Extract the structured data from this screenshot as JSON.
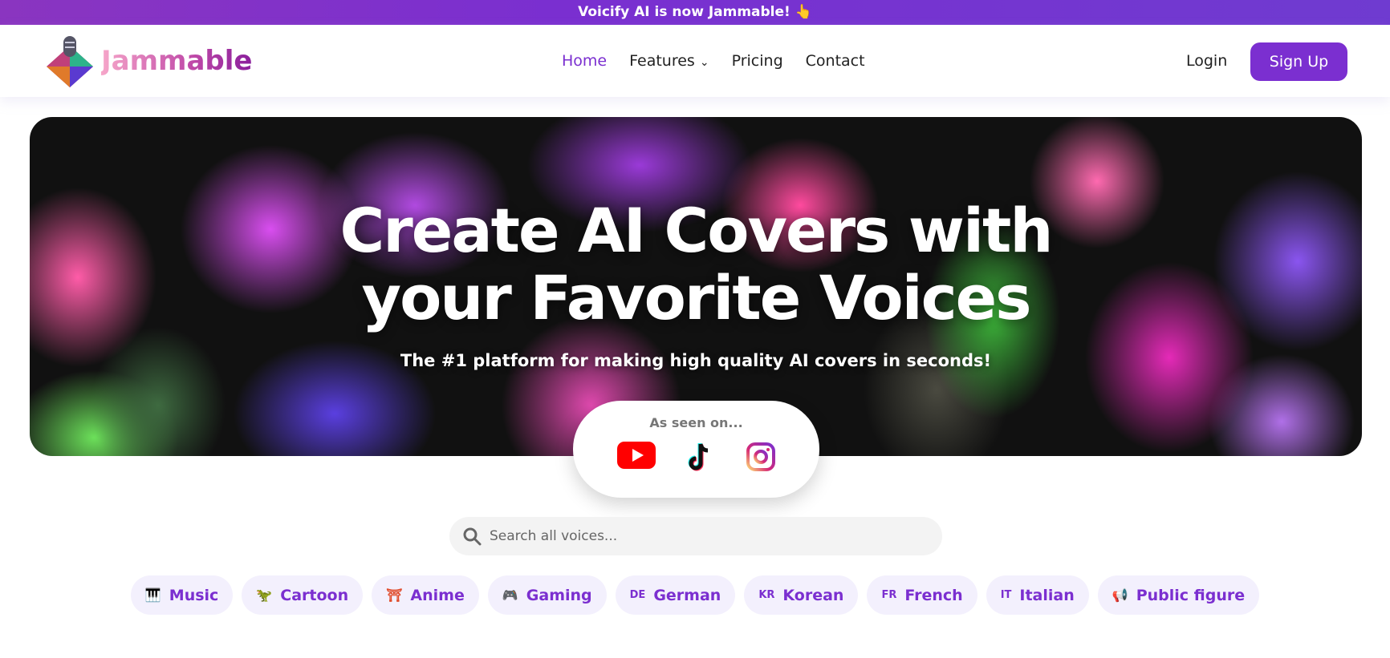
{
  "banner": {
    "text": "Voicify AI is now Jammable! 👆"
  },
  "logo": {
    "text": "Jammable"
  },
  "nav": {
    "items": [
      {
        "label": "Home",
        "active": true
      },
      {
        "label": "Features",
        "dropdown": true
      },
      {
        "label": "Pricing"
      },
      {
        "label": "Contact"
      }
    ],
    "login": "Login",
    "signup": "Sign Up"
  },
  "hero": {
    "title_line1": "Create AI Covers with",
    "title_line2": "your Favorite Voices",
    "subtitle": "The #1 platform for making high quality AI covers in seconds!"
  },
  "seen_on": {
    "label": "As seen on...",
    "platforms": [
      "youtube-icon",
      "tiktok-icon",
      "instagram-icon"
    ]
  },
  "search": {
    "placeholder": "Search all voices..."
  },
  "categories": [
    {
      "icon": "🎹",
      "label": "Music"
    },
    {
      "icon": "🦖",
      "label": "Cartoon"
    },
    {
      "icon": "⛩",
      "label": "Anime"
    },
    {
      "icon": "🎮",
      "label": "Gaming"
    },
    {
      "code": "DE",
      "label": "German"
    },
    {
      "code": "KR",
      "label": "Korean"
    },
    {
      "code": "FR",
      "label": "French"
    },
    {
      "code": "IT",
      "label": "Italian"
    },
    {
      "icon": "📢",
      "label": "Public figure"
    }
  ],
  "colors": {
    "accent": "#7b2fd0",
    "chip_bg": "#f3f0fd"
  }
}
